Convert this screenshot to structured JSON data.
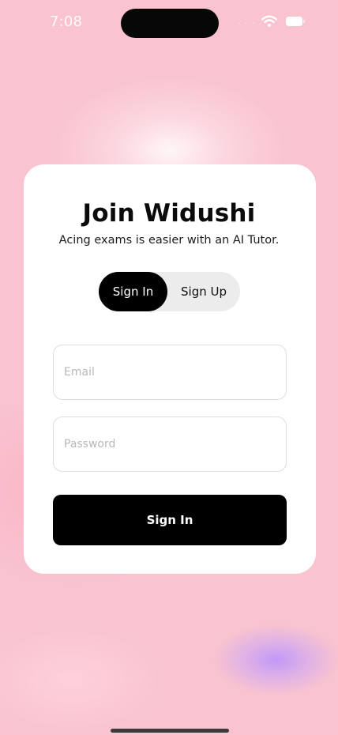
{
  "status_bar": {
    "time": "7:08",
    "signal_icon": "cellular-dots-icon",
    "wifi_icon": "wifi-icon",
    "battery_icon": "battery-icon"
  },
  "auth": {
    "title": "Join Widushi",
    "subtitle": "Acing exams is easier with an AI Tutor.",
    "tabs": [
      {
        "label": "Sign In",
        "selected": true
      },
      {
        "label": "Sign Up",
        "selected": false
      }
    ],
    "email": {
      "placeholder": "Email",
      "value": ""
    },
    "password": {
      "placeholder": "Password",
      "value": ""
    },
    "submit_label": "Sign In"
  },
  "colors": {
    "background": "#f9c3d0",
    "card": "#ffffff",
    "accent": "#000000",
    "toggle_track": "#ececec"
  }
}
